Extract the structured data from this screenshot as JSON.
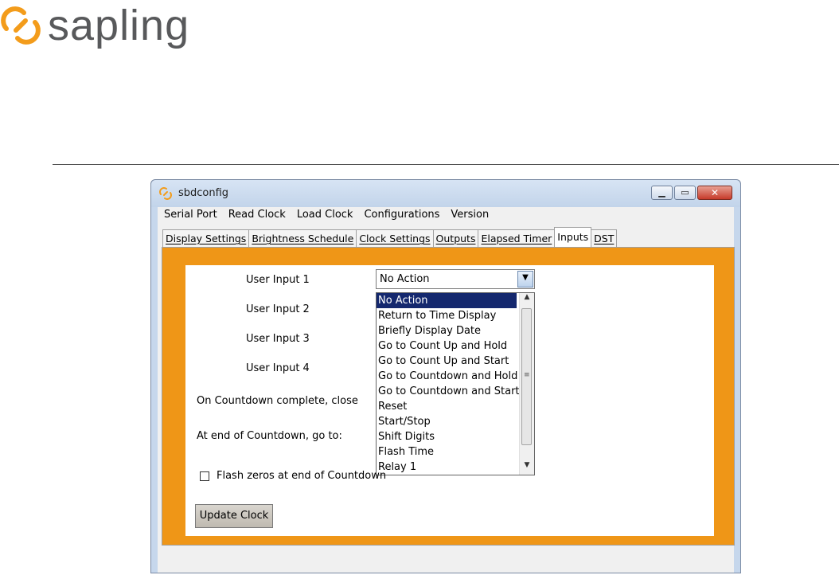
{
  "brand": {
    "name": "sapling",
    "icon": "sapling-logo-icon",
    "color": "#f39c1b"
  },
  "window": {
    "title": "sbdconfig",
    "title_icon": "sapling-app-icon",
    "controls": {
      "minimize": "minimize-icon",
      "maximize": "maximize-icon",
      "close": "close-icon"
    }
  },
  "menu": [
    "Serial Port",
    "Read Clock",
    "Load Clock",
    "Configurations",
    "Version"
  ],
  "tabs": [
    {
      "label": "Display Settings",
      "active": false
    },
    {
      "label": "Brightness Schedule",
      "active": false
    },
    {
      "label": "Clock Settings",
      "active": false
    },
    {
      "label": "Outputs",
      "active": false
    },
    {
      "label": "Elapsed Timer",
      "active": false
    },
    {
      "label": "Inputs",
      "active": true
    },
    {
      "label": "DST",
      "active": false
    }
  ],
  "form": {
    "labels": {
      "input1": "User Input 1",
      "input2": "User Input 2",
      "input3": "User Input 3",
      "input4": "User Input 4",
      "countdown_close": "On Countdown complete, close",
      "countdown_goto": "At end of Countdown, go to:"
    },
    "selected_value": "No Action",
    "dropdown_options": [
      "No Action",
      "Return to Time Display",
      "Briefly Display Date",
      "Go to Count Up and Hold",
      "Go to Count Up and Start",
      "Go to Countdown and Hold",
      "Go to Countdown and Start",
      "Reset",
      "Start/Stop",
      "Shift Digits",
      "Flash Time",
      "Relay 1"
    ],
    "checkbox_label": "Flash zeros at end of Countdown",
    "checkbox_checked": false,
    "update_button": "Update Clock"
  },
  "colors": {
    "panel": "#ef9617",
    "selection": "#14286e"
  }
}
